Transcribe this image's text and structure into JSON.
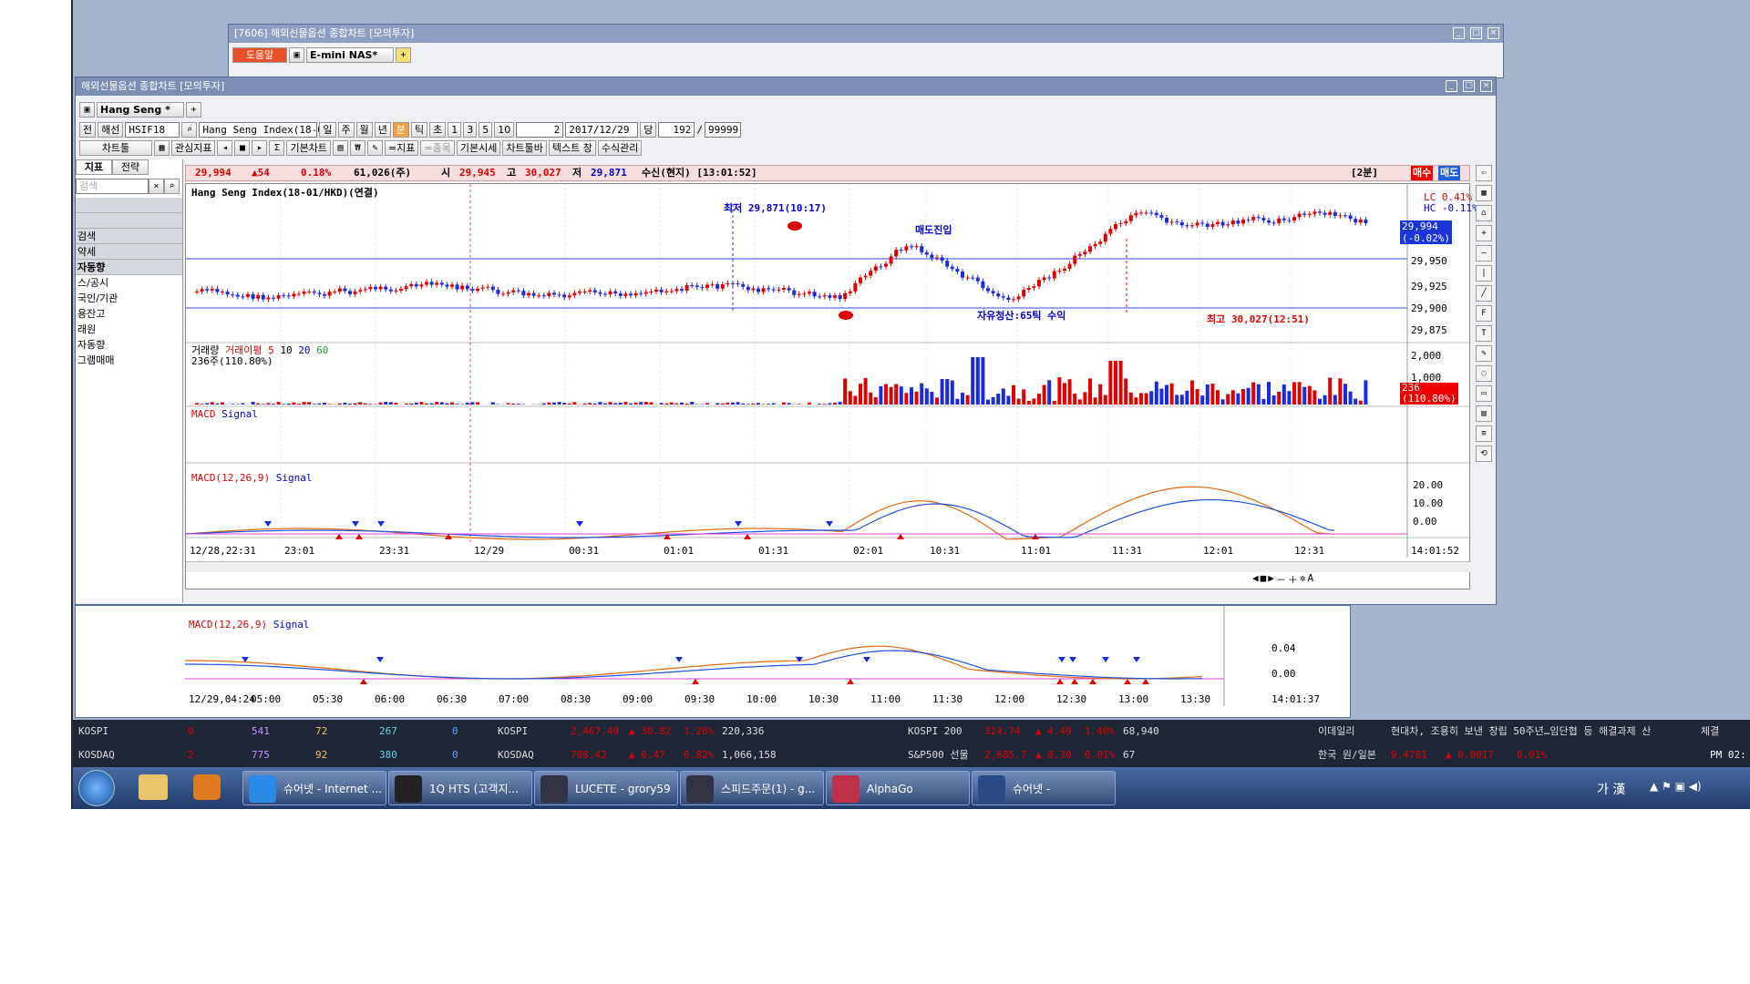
{
  "back_window": {
    "title": "[7606] 해외선물옵션 종합차트 [모의투자]",
    "help_btn": "도움말",
    "product_tab": "E-mini NAS*"
  },
  "main_window": {
    "title": "해외선물옵션 종합차트 [모의투자]",
    "product_tab": "Hang Seng *"
  },
  "toolbar1": {
    "b1": "전",
    "b2": "해선",
    "code": "HSIF18",
    "name": "Hang Seng Index(18-01",
    "periods": [
      "일",
      "주",
      "월",
      "년",
      "분",
      "틱",
      "초"
    ],
    "active_period": "분",
    "nums": [
      "1",
      "3",
      "5",
      "10"
    ],
    "interval": "2",
    "date": "2017/12/29",
    "dang": "당",
    "count": "192",
    "total": "99999"
  },
  "toolbar2": {
    "chart_tools": "차트툴",
    "interest": "관심지표",
    "basic": "기본차트",
    "indicator": "=지표",
    "stock": "=종목",
    "basic_quote": "기본시세",
    "toolbar": "차트툴바",
    "text": "텍스트 창",
    "formula": "수식관리"
  },
  "side_tabs": {
    "t1": "지표",
    "t2": "전략"
  },
  "side_search_placeholder": "검색",
  "side_items": [
    "검색",
    "약세",
    "자동향",
    "스/공시",
    "국인/기관",
    "용잔고",
    "래원",
    "자동향",
    "그램매매"
  ],
  "quote": {
    "price": "29,994",
    "change": "▲54",
    "pct": "0.18%",
    "volume": "61,026(주)",
    "open_l": "시",
    "open": "29,945",
    "high_l": "고",
    "high": "30,027",
    "low_l": "저",
    "low": "29,871",
    "recv": "수신(현지) [13:01:52]",
    "period": "[2분]",
    "sell": "매수",
    "buy": "매도"
  },
  "pane_price": {
    "title": "Hang Seng Index(18-01/HKD)(연결)",
    "lc": "LC  0.41%",
    "hc": "HC -0.11%",
    "cur_price": "29,994",
    "cur_pct": "(-0.02%)",
    "ticks": [
      "29,950",
      "29,925",
      "29,900",
      "29,875"
    ],
    "low_ann": "최저 29,871(10:17)",
    "high_ann": "최고 30,027(12:51)",
    "sell_entry": "매도진입",
    "exit_ann": "자유청산:65틱 수익"
  },
  "pane_volume": {
    "title": "거래량",
    "ma_label": "거래이평",
    "ma": [
      "5",
      "10",
      "20",
      "60"
    ],
    "value": "236주(110.80%)",
    "ticks": [
      "2,000",
      "1,000"
    ],
    "cur": "236",
    "cur_pct": "(110.80%)"
  },
  "pane_macd1": {
    "title": "MACD",
    "signal": "Signal"
  },
  "pane_macd2": {
    "title": "MACD(12,26,9)",
    "signal": "Signal",
    "ticks": [
      "20.00",
      "10.00",
      "0.00"
    ]
  },
  "x_axis": {
    "labels": [
      "12/28,22:31",
      "23:01",
      "23:31",
      "12/29",
      "00:31",
      "01:01",
      "01:31",
      "02:01",
      "10:31",
      "11:01",
      "11:31",
      "12:01",
      "12:31"
    ],
    "time": "14:01:52"
  },
  "lower_pane": {
    "title": "MACD(12,26,9)",
    "signal": "Signal",
    "ticks": [
      "0.04",
      "0.00"
    ],
    "x_labels": [
      "12/29,04:24",
      "05:00",
      "05:30",
      "06:00",
      "06:30",
      "07:00",
      "08:30",
      "09:00",
      "09:30",
      "10:00",
      "10:30",
      "11:00",
      "11:30",
      "12:00",
      "12:30",
      "13:00",
      "13:30"
    ],
    "time": "14:01:37"
  },
  "ticker": {
    "r1": {
      "name": "KOSPI",
      "a": "0",
      "b": "541",
      "c": "72",
      "d": "267",
      "e": "0",
      "name2": "KOSPI",
      "v1": "2,467.49",
      "v2": "▲ 30.82",
      "v3": "1.26%",
      "v4": "220,336",
      "name3": "KOSPI 200",
      "w1": "324.74",
      "w2": "▲ 4.49",
      "w3": "1.40%",
      "w4": "68,940",
      "news_src": "이데일리",
      "news": "현대차, 조용히 보낸 창립 50주년…임단협 등 해결과제 산",
      "tag": "체결"
    },
    "r2": {
      "name": "KOSDAQ",
      "a": "2",
      "b": "775",
      "c": "92",
      "d": "380",
      "e": "0",
      "name2": "KOSDAQ",
      "v1": "798.42",
      "v2": "▲ 6.47",
      "v3": "0.82%",
      "v4": "1,066,158",
      "name3": "S&P500 선물",
      "w1": "2,685.7",
      "w2": "▲ 0.30",
      "w3": "0.01%",
      "w4": "67",
      "fx": "한국 원/일본",
      "x1": "9.4781",
      "x2": "▲ 0.0017",
      "x3": "0.01%",
      "clock": "PM 02:"
    }
  },
  "taskbar": {
    "tasks": [
      "슈어넷 - Internet ...",
      "1Q HTS (고객지...",
      "LUCETE - grory59",
      "스피드주문(1) - g...",
      "AlphaGo",
      "슈어넷 -"
    ],
    "ime": "가 漢"
  }
}
